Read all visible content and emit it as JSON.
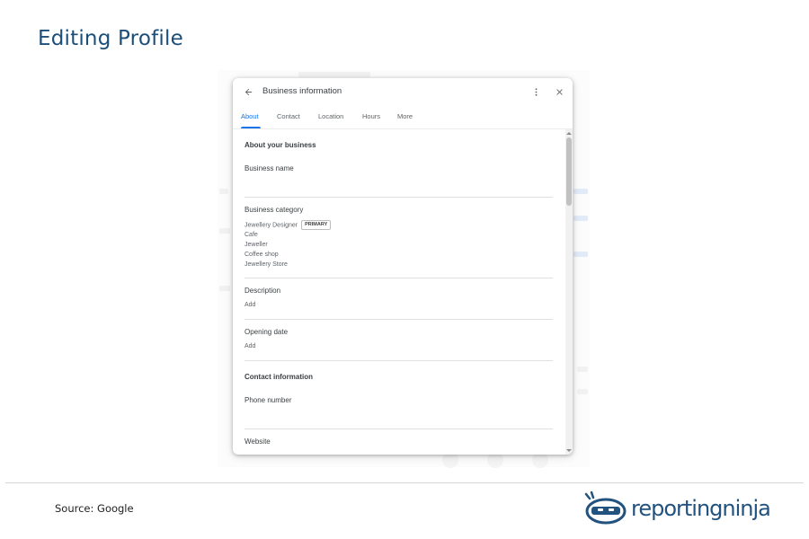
{
  "slide": {
    "title": "Editing Profile",
    "source": "Source: Google",
    "logo_text": "reportingninja"
  },
  "dialog": {
    "title": "Business information",
    "tabs": [
      {
        "label": "About",
        "active": true
      },
      {
        "label": "Contact",
        "active": false
      },
      {
        "label": "Location",
        "active": false
      },
      {
        "label": "Hours",
        "active": false
      },
      {
        "label": "More",
        "active": false
      }
    ],
    "about_section": "About your business",
    "business_name_label": "Business name",
    "business_category_label": "Business category",
    "categories": [
      "Jewellery Designer",
      "Cafe",
      "Jeweller",
      "Coffee shop",
      "Jewellery Store"
    ],
    "primary_badge": "PRIMARY",
    "description_label": "Description",
    "description_add": "Add",
    "opening_date_label": "Opening date",
    "opening_date_add": "Add",
    "contact_section": "Contact information",
    "phone_label": "Phone number",
    "website_label": "Website"
  },
  "colors": {
    "accent": "#1a73e8",
    "title": "#1c4e7a",
    "logo": "#22527e"
  },
  "icons": {
    "back": "arrow-back-icon",
    "more": "more-vert-icon",
    "close": "close-icon"
  }
}
